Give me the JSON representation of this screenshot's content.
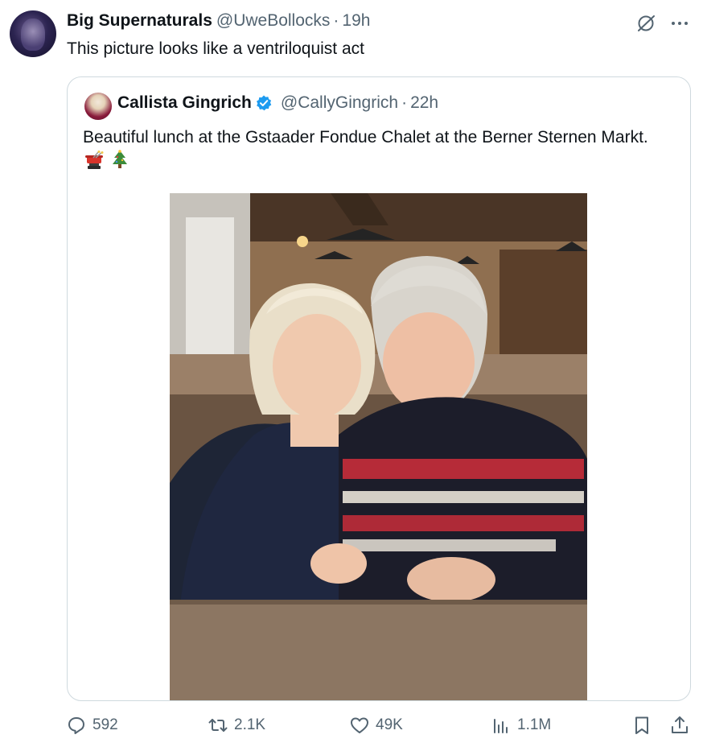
{
  "tweet": {
    "author_name": "Big Supernaturals",
    "author_handle": "@UweBollocks",
    "separator": "·",
    "time": "19h",
    "text": "This picture looks like a ventriloquist act"
  },
  "quoted": {
    "author_name": "Callista Gingrich",
    "author_handle": "@CallyGingrich",
    "separator": "·",
    "time": "22h",
    "text": "Beautiful lunch at the Gstaader Fondue Chalet at the Berner Sternen Markt.",
    "emojis": [
      "fondue-pot",
      "christmas-tree"
    ]
  },
  "actions": {
    "replies": "592",
    "reposts": "2.1K",
    "likes": "49K",
    "views": "1.1M"
  },
  "icons": [
    "grok-icon",
    "more-icon",
    "verified-icon",
    "reply-icon",
    "retweet-icon",
    "like-icon",
    "views-icon",
    "bookmark-icon",
    "share-icon"
  ],
  "colors": {
    "text": "#0f1419",
    "secondary": "#536471",
    "verified": "#1d9bf0",
    "border": "#cfd9de"
  }
}
